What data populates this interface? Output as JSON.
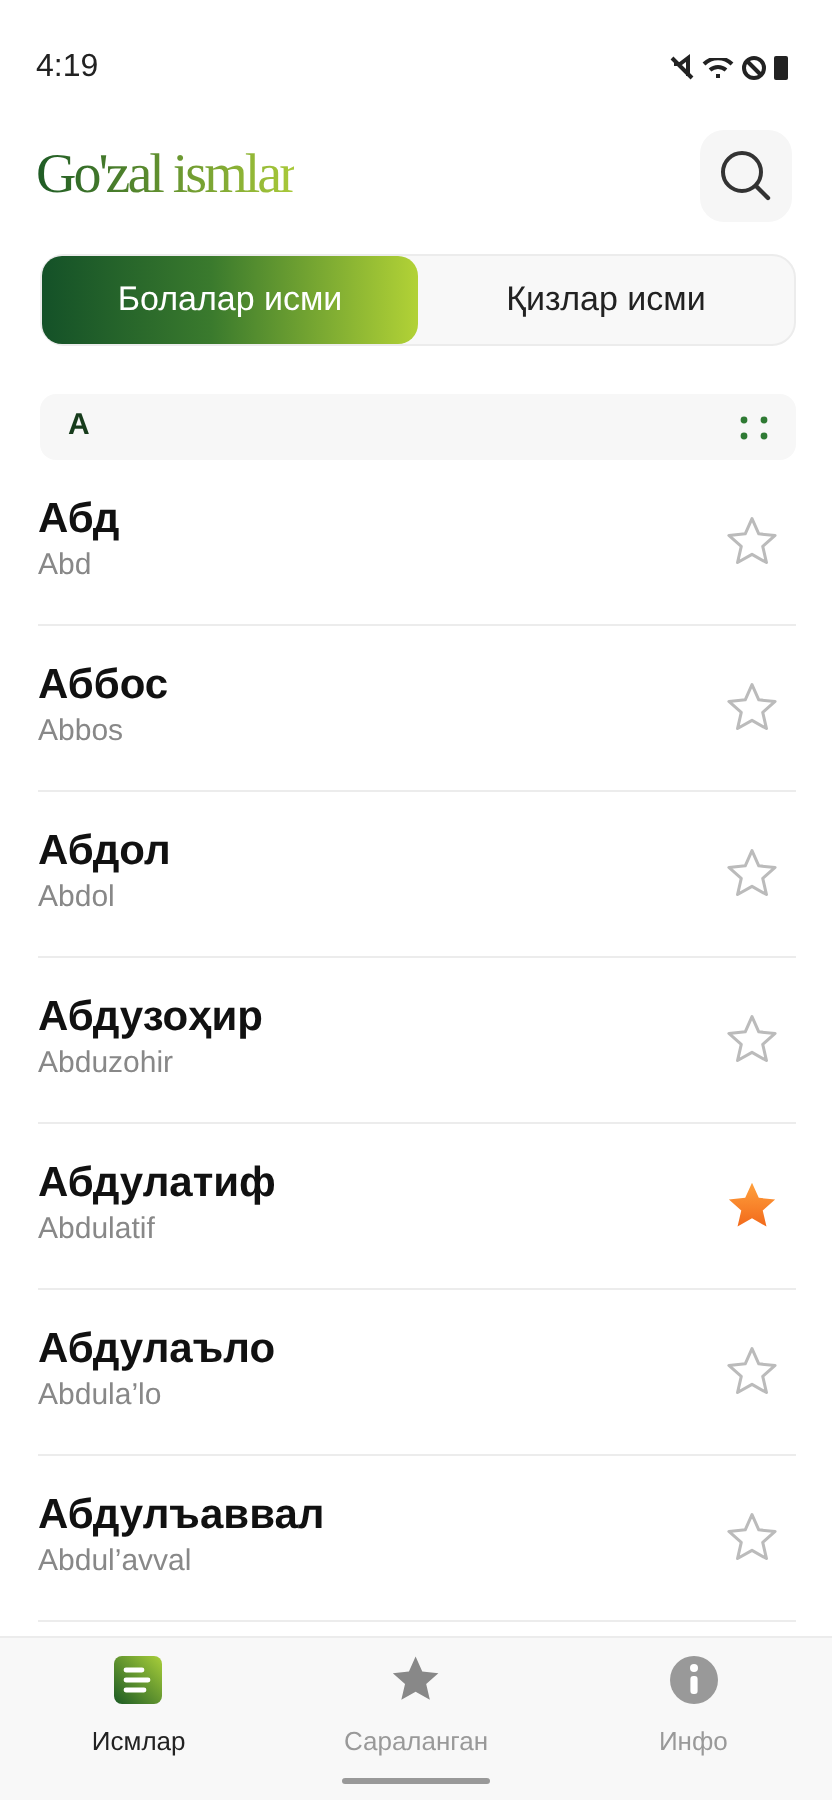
{
  "status_bar": {
    "time": "4:19"
  },
  "header": {
    "title": "Go'zal ismlar"
  },
  "tabs": [
    {
      "label": "Болалар исми",
      "selected": true
    },
    {
      "label": "Қизлар исми",
      "selected": false
    }
  ],
  "section": {
    "letter": "А"
  },
  "names": [
    {
      "name": "Абд",
      "latin": "Abd",
      "favorite": false
    },
    {
      "name": "Аббос",
      "latin": "Abbos",
      "favorite": false
    },
    {
      "name": "Абдол",
      "latin": "Abdol",
      "favorite": false
    },
    {
      "name": "Абдузоҳир",
      "latin": "Abduzohir",
      "favorite": false
    },
    {
      "name": "Абдулатиф",
      "latin": "Abdulatif",
      "favorite": true
    },
    {
      "name": "Абдулаъло",
      "latin": "Abdula’lo",
      "favorite": false
    },
    {
      "name": "Абдулъаввал",
      "latin": "Abdul’avval",
      "favorite": false
    }
  ],
  "bottom_nav": [
    {
      "label": "Исмлар",
      "kind": "list",
      "selected": true
    },
    {
      "label": "Сараланган",
      "kind": "star",
      "selected": false
    },
    {
      "label": "Инфо",
      "kind": "info",
      "selected": false
    }
  ]
}
